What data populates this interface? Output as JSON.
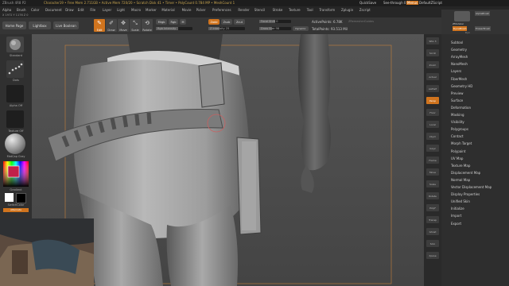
{
  "titlebar": {
    "app_title": "ZBrush 4R8 P2",
    "doc_title": "Character19 • Free Mem 2.711GB • Active Mem 720/20 • Scratch Disk 41 • Timer • PolyCount 0.784 MP • MeshCount 1",
    "quicksave": "QuickSave",
    "see_through": "See-through 0",
    "menus_label": "Menus",
    "default_zscript": "DefaultZScript"
  },
  "menubar": {
    "items": [
      "Alpha",
      "Brush",
      "Color",
      "Document",
      "Draw",
      "Edit",
      "File",
      "Layer",
      "Light",
      "Macro",
      "Marker",
      "Material",
      "Movie",
      "Picker",
      "Preferences",
      "Render",
      "Stencil",
      "Stroke",
      "Texture",
      "Tool",
      "Transform",
      "Zplugin",
      "Zscript"
    ]
  },
  "infobar": {
    "text": "X 1972 Y 1176 Z 0"
  },
  "shelf": {
    "home_page": "Home Page",
    "lightbox": "Lightbox",
    "live_boolean": "Live Boolean",
    "tools": [
      {
        "label": "Edit",
        "active": true
      },
      {
        "label": "Draw",
        "active": false
      },
      {
        "label": "Move",
        "active": false
      },
      {
        "label": "Scale",
        "active": false
      },
      {
        "label": "Rotate",
        "active": false
      }
    ],
    "mrgb": "Mrgb",
    "rgb": "Rgb",
    "m": "M",
    "zadd": "Zadd",
    "zsub": "Zsub",
    "zcut": "Zcut",
    "rgb_intensity": "Rgb Intensity",
    "z_intensity": "Z Intensity 25",
    "focal_shift": "Focal Shift 0",
    "draw_size": "Draw Size 98",
    "dynamic": "Dynamic",
    "active_points": "ActivePoints: 6.78K",
    "total_points": "TotalPoints: 93.513 Mil",
    "zremesher_guides": "ZRemesherGuides"
  },
  "brushpanel": {
    "brush1": "ZModeler",
    "brush2": "AlphaBrush",
    "brush3": "DynaBrush",
    "brush4": "EraserBrush",
    "dyn": "Dyn"
  },
  "leftpanel": {
    "brush_label": "Standard",
    "stroke_label": "Dots",
    "alpha_label": "Alpha Off",
    "texture_label": "Texture Off",
    "material_label": "MatCap Gray",
    "gradient_label": "Gradient",
    "switch_color": "SwitchColor",
    "alternate": "Alternate"
  },
  "rightcol": {
    "buttons": [
      {
        "label": "SPix 3",
        "active": false
      },
      {
        "label": "Scroll",
        "active": false
      },
      {
        "label": "Zoom",
        "active": false
      },
      {
        "label": "Actual",
        "active": false
      },
      {
        "label": "AAHalf",
        "active": false
      },
      {
        "label": "Persp",
        "active": true
      },
      {
        "label": "Floor",
        "active": false
      },
      {
        "label": "Local",
        "active": false
      },
      {
        "label": "LSym",
        "active": false
      },
      {
        "label": "Gxyz",
        "active": false
      },
      {
        "label": "Frame",
        "active": false
      },
      {
        "label": "Move",
        "active": false
      },
      {
        "label": "Scale",
        "active": false
      },
      {
        "label": "Rotate",
        "active": false
      },
      {
        "label": "PolyF",
        "active": false
      },
      {
        "label": "Transp",
        "active": false
      },
      {
        "label": "Ghost",
        "active": false
      },
      {
        "label": "Solo",
        "active": false
      },
      {
        "label": "Xpose",
        "active": false
      }
    ]
  },
  "rightmenu": {
    "items": [
      "Subtool",
      "Geometry",
      "ArrayMesh",
      "NanoMesh",
      "Layers",
      "FiberMesh",
      "Geometry HD",
      "Preview",
      "Surface",
      "Deformation",
      "Masking",
      "Visibility",
      "Polygroups",
      "Contact",
      "Morph Target",
      "Polypaint",
      "UV Map",
      "Texture Map",
      "Displacement Map",
      "Normal Map",
      "Vector Displacement Map",
      "Display Properties",
      "Unified Skin",
      "Initialize",
      "Import",
      "Export"
    ]
  },
  "colors": {
    "accent": "#d0741e",
    "canvas_bg": "#4a4a4a",
    "panel_bg": "#2e2e2e"
  }
}
